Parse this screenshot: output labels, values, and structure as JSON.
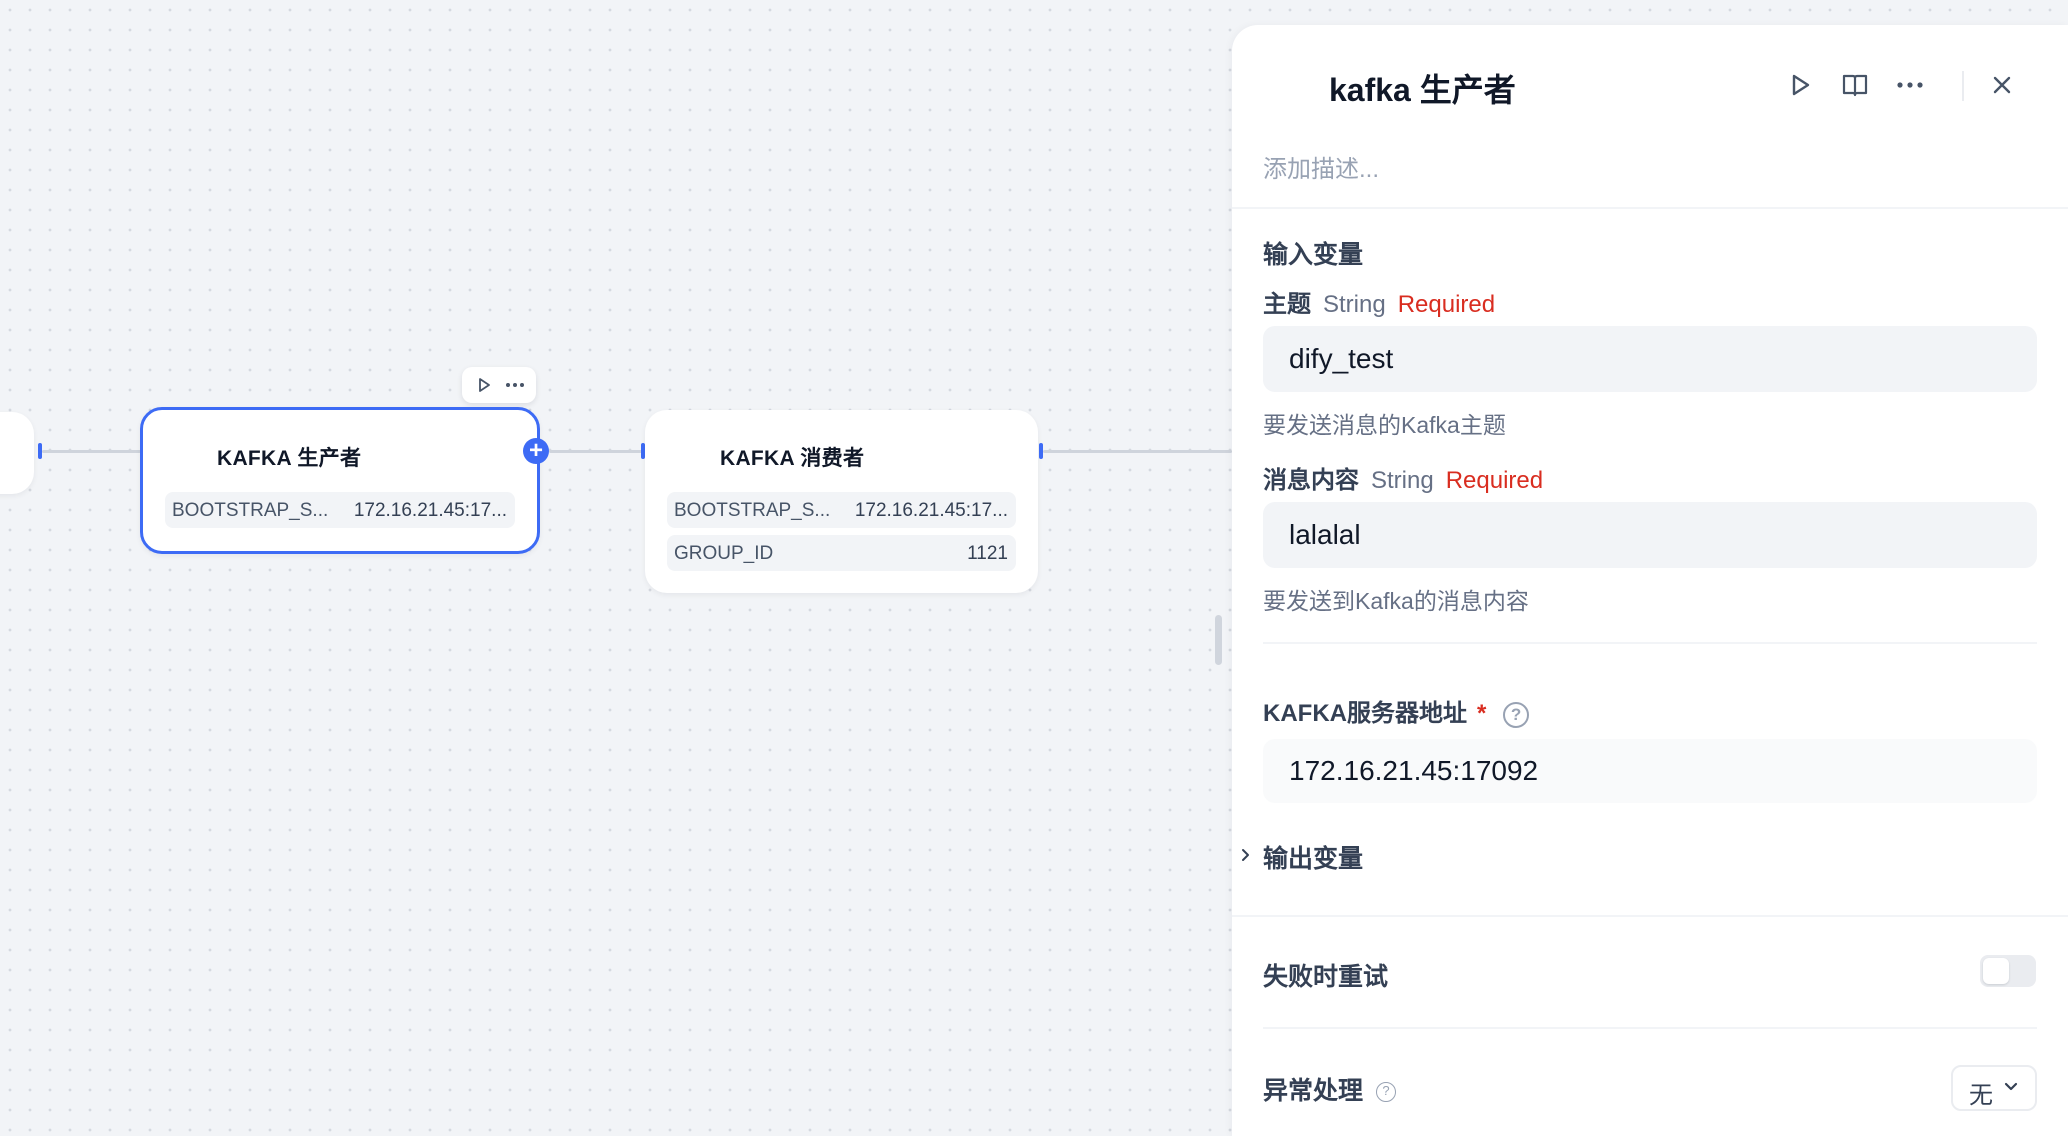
{
  "canvas": {
    "nodes": [
      {
        "title": "KAFKA 生产者",
        "rows": [
          {
            "key": "BOOTSTRAP_S...",
            "value": "172.16.21.45:17..."
          }
        ]
      },
      {
        "title": "KAFKA 消费者",
        "rows": [
          {
            "key": "BOOTSTRAP_S...",
            "value": "172.16.21.45:17..."
          },
          {
            "key": "GROUP_ID",
            "value": "1121"
          }
        ]
      }
    ],
    "toolbar_icons": [
      "play-icon",
      "more-icon"
    ],
    "accent_color": "#3d6bf5"
  },
  "panel": {
    "title": "kafka 生产者",
    "description_placeholder": "添加描述...",
    "header_icons": [
      "play-icon",
      "book-icon",
      "more-icon",
      "close-icon"
    ],
    "input_section_title": "输入变量",
    "fields": [
      {
        "name": "主题",
        "type": "String",
        "required": "Required",
        "value": "dify_test",
        "hint": "要发送消息的Kafka主题"
      },
      {
        "name": "消息内容",
        "type": "String",
        "required": "Required",
        "value": "lalalal",
        "hint": "要发送到Kafka的消息内容"
      }
    ],
    "server_label": "KAFKA服务器地址",
    "server_required_mark": "*",
    "server_value": "172.16.21.45:17092",
    "output_section_title": "输出变量",
    "retry_label": "失败时重试",
    "retry_enabled": false,
    "error_label": "异常处理",
    "error_value": "无"
  }
}
